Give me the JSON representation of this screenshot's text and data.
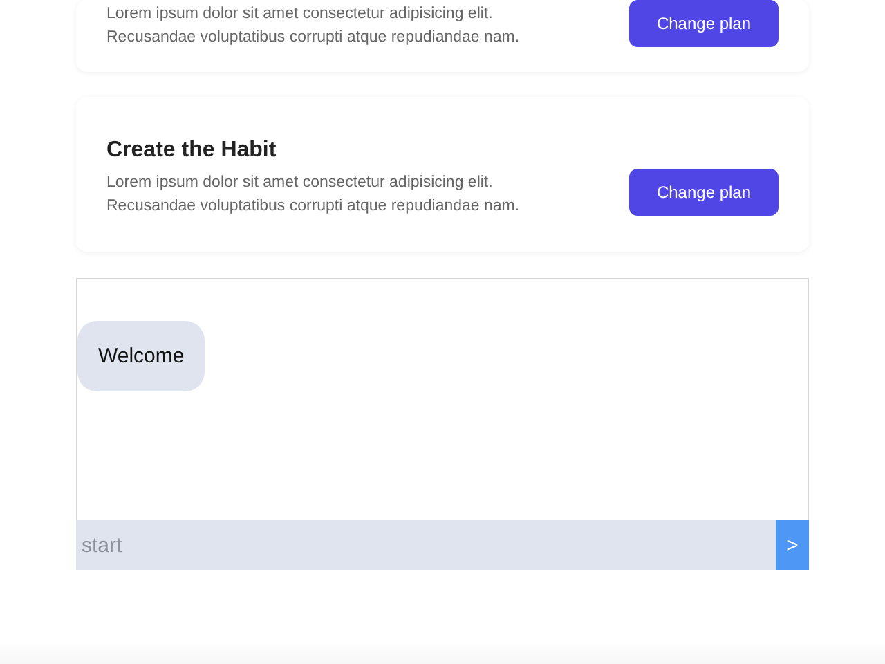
{
  "plans": [
    {
      "description": "Lorem ipsum dolor sit amet consectetur adipisicing elit. Recusandae voluptatibus corrupti atque repudiandae nam.",
      "button": "Change plan"
    },
    {
      "title": "Create the Habit",
      "description": "Lorem ipsum dolor sit amet consectetur adipisicing elit. Recusandae voluptatibus corrupti atque repudiandae nam.",
      "button": "Change plan"
    }
  ],
  "chat": {
    "messages": [
      "Welcome"
    ],
    "input": {
      "placeholder": "start"
    },
    "send_button": ">"
  }
}
